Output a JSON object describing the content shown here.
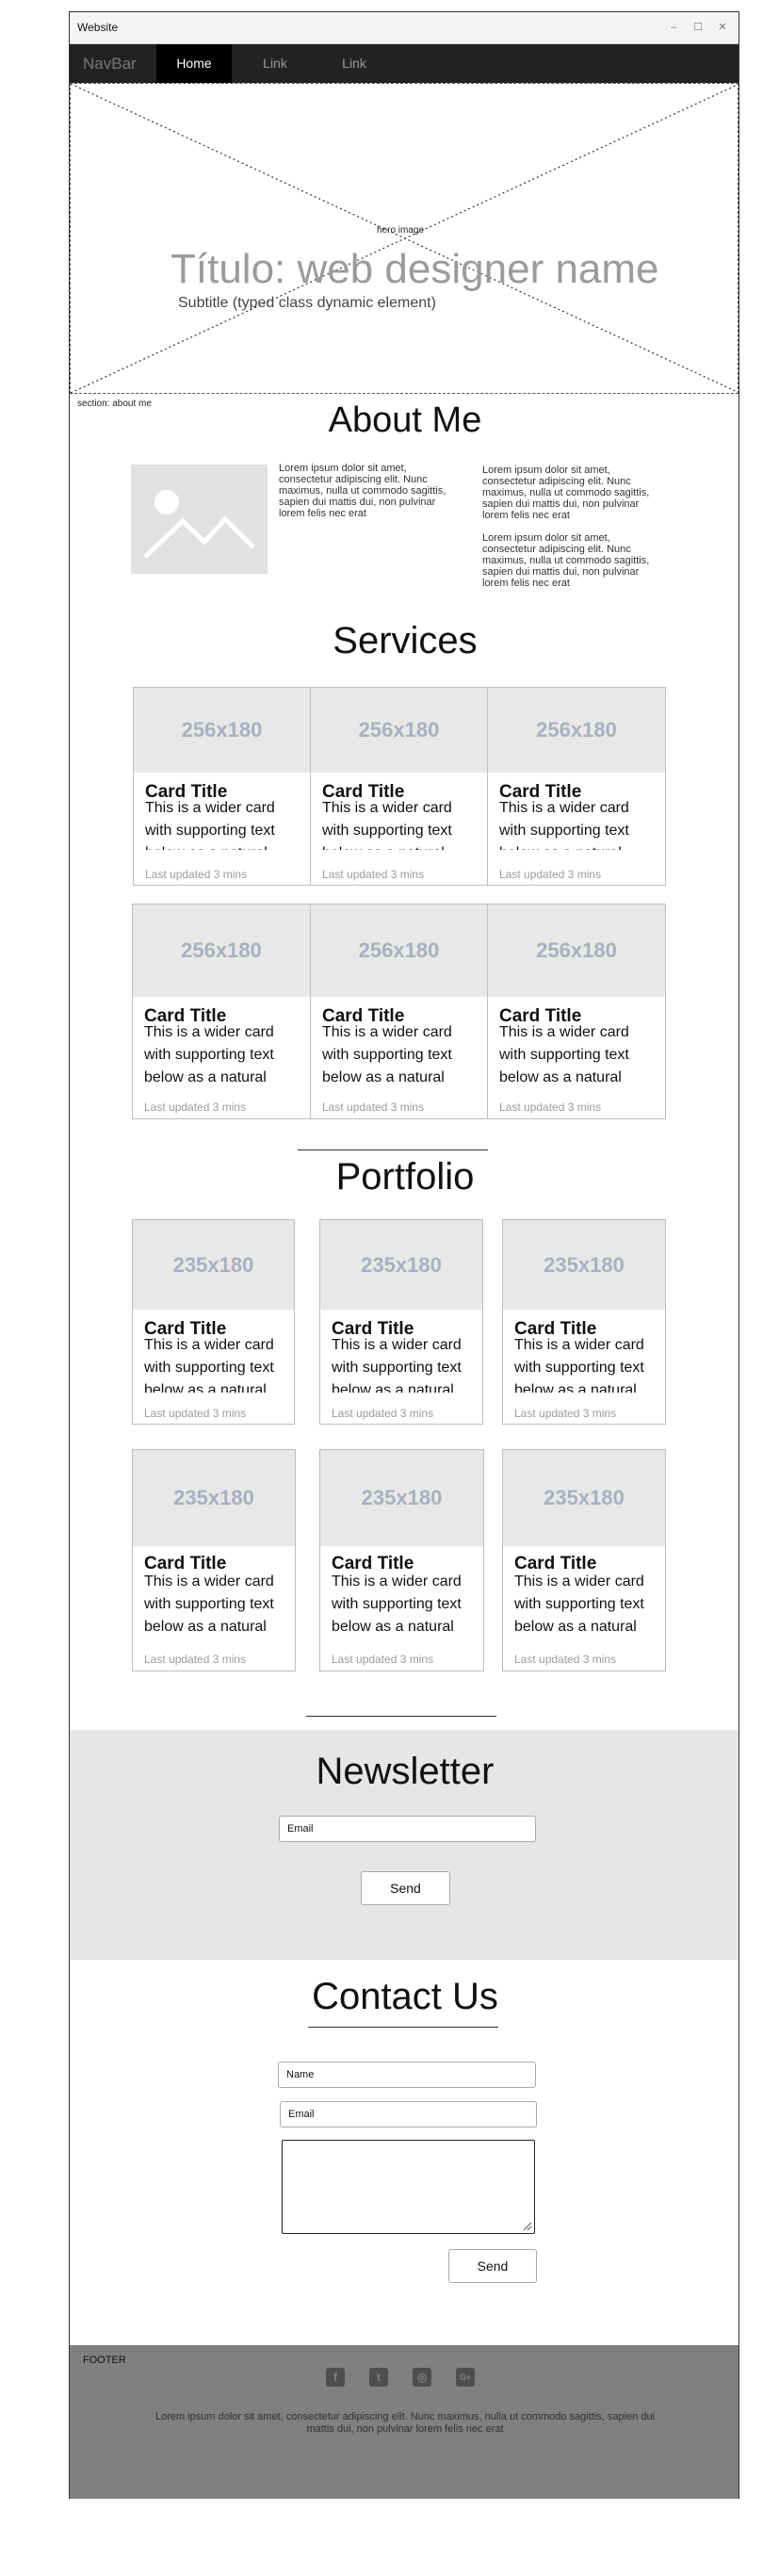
{
  "window": {
    "title": "Website",
    "minimize": "–",
    "maximize": "☐",
    "close": "✕"
  },
  "navbar": {
    "brand": "NavBar",
    "links": [
      "Home",
      "Link",
      "Link"
    ]
  },
  "hero": {
    "image_label": "hero image",
    "title": "Título: web designer name",
    "subtitle": "Subtitle (typed class  dynamic element)"
  },
  "about": {
    "section_label": "section: about me",
    "heading": "About Me",
    "col1": "Lorem ipsum dolor sit amet, consectetur adipiscing elit. Nunc maximus, nulla ut commodo sagittis, sapien dui mattis dui, non pulvinar lorem felis nec erat",
    "col2a": "Lorem ipsum dolor sit amet, consectetur adipiscing elit. Nunc maximus, nulla ut commodo sagittis, sapien dui mattis dui, non pulvinar lorem felis nec erat",
    "col2b": "Lorem ipsum dolor sit amet, consectetur adipiscing elit. Nunc maximus, nulla ut commodo sagittis, sapien dui mattis dui, non pulvinar lorem felis nec erat"
  },
  "services": {
    "heading": "Services",
    "cards": [
      {
        "img": "256x180",
        "title": "Card Title",
        "text": "This is a wider card with supporting text below as a natural",
        "footer": "Last updated 3 mins"
      },
      {
        "img": "256x180",
        "title": "Card Title",
        "text": "This is a wider card with supporting text below as a natural",
        "footer": "Last updated 3 mins"
      },
      {
        "img": "256x180",
        "title": "Card Title",
        "text": "This is a wider card with supporting text below as a natural",
        "footer": "Last updated 3 mins"
      },
      {
        "img": "256x180",
        "title": "Card Title",
        "text": "This is a wider card with supporting text below as a natural",
        "footer": "Last updated 3 mins"
      },
      {
        "img": "256x180",
        "title": "Card Title",
        "text": "This is a wider card with supporting text below as a natural",
        "footer": "Last updated 3 mins"
      },
      {
        "img": "256x180",
        "title": "Card Title",
        "text": "This is a wider card with supporting text below as a natural",
        "footer": "Last updated 3 mins"
      }
    ]
  },
  "portfolio": {
    "heading": "Portfolio",
    "cards": [
      {
        "img": "235x180",
        "title": "Card Title",
        "text": "This is a wider card with supporting text below as a natural",
        "footer": "Last updated 3 mins"
      },
      {
        "img": "235x180",
        "title": "Card Title",
        "text": "This is a wider card with supporting text below as a natural",
        "footer": "Last updated 3 mins"
      },
      {
        "img": "235x180",
        "title": "Card Title",
        "text": "This is a wider card with supporting text below as a natural",
        "footer": "Last updated 3 mins"
      },
      {
        "img": "235x180",
        "title": "Card Title",
        "text": "This is a wider card with supporting text below as a natural",
        "footer": "Last updated 3 mins"
      },
      {
        "img": "235x180",
        "title": "Card Title",
        "text": "This is a wider card with supporting text below as a natural",
        "footer": "Last updated 3 mins"
      },
      {
        "img": "235x180",
        "title": "Card Title",
        "text": "This is a wider card with supporting text below as a natural",
        "footer": "Last updated 3 mins"
      }
    ]
  },
  "newsletter": {
    "heading": "Newsletter",
    "email_placeholder": "Email",
    "send": "Send"
  },
  "contact": {
    "heading": "Contact Us",
    "name_placeholder": "Name",
    "email_placeholder": "Email",
    "send": "Send"
  },
  "footer": {
    "label": "FOOTER",
    "icons": [
      "f",
      "t",
      "◎",
      "G+"
    ],
    "text": "Lorem ipsum dolor sit amet, consectetur adipiscing elit. Nunc maximus, nulla ut commodo sagittis, sapien dui mattis dui, non pulvinar lorem felis nec erat"
  }
}
